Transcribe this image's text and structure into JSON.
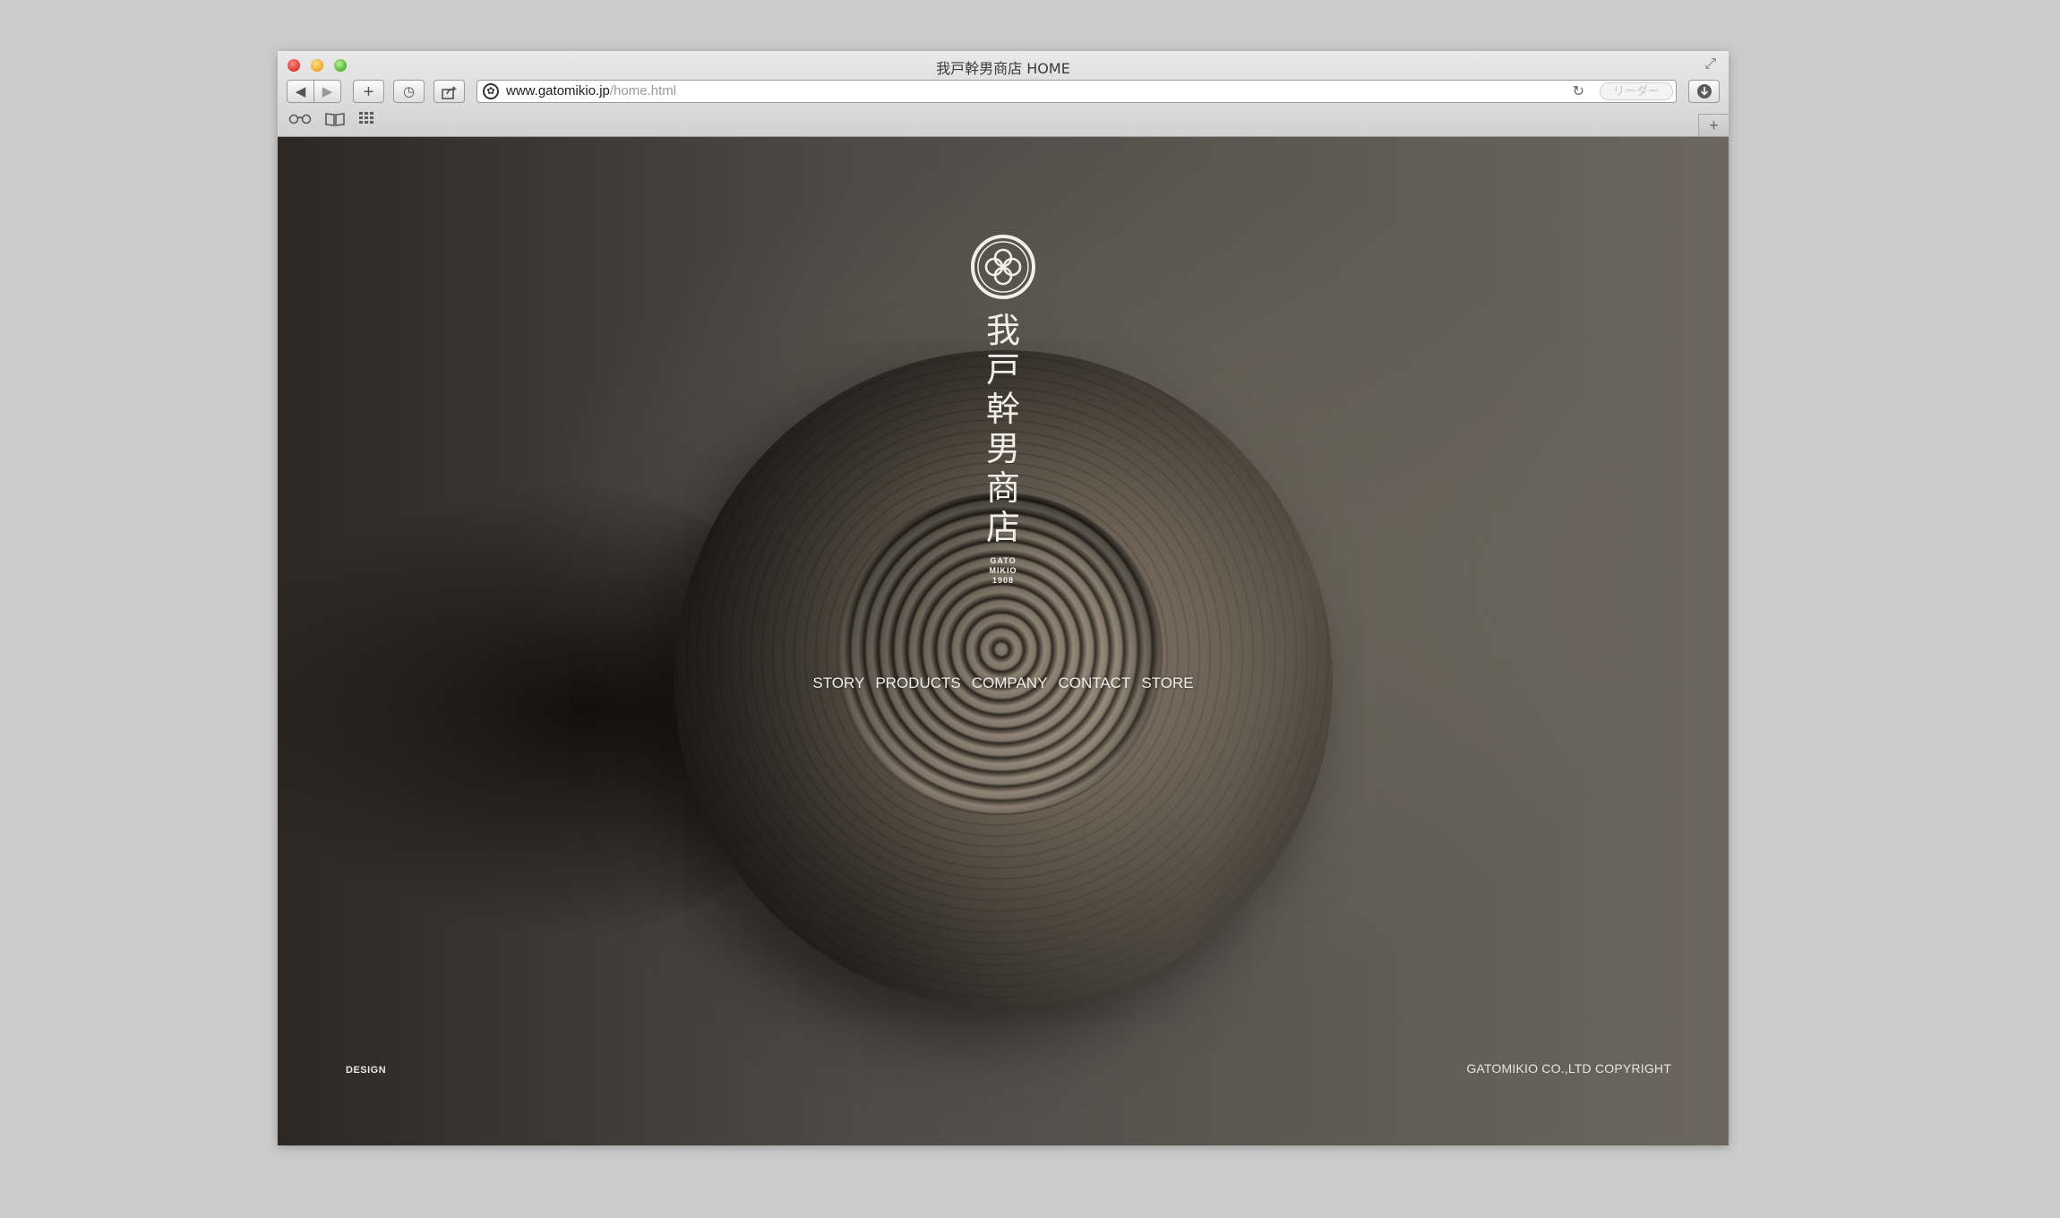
{
  "browser": {
    "window_title": "我戸幹男商店 HOME",
    "url_domain": "www.gatomikio.jp",
    "url_path": "/home.html",
    "reader_label": "リーダー",
    "icons": {
      "back": "back-arrow-icon",
      "forward": "forward-arrow-icon",
      "add": "plus-icon",
      "history": "clock-icon",
      "share": "share-icon",
      "reload": "reload-icon",
      "downloads": "download-icon",
      "reading_list": "glasses-icon",
      "bookmarks": "book-icon",
      "top_sites": "grid-icon",
      "new_tab": "plus-icon"
    }
  },
  "page": {
    "brand": {
      "name_chars": [
        "我",
        "戸",
        "幹",
        "男",
        "商",
        "店"
      ],
      "sub_lines": [
        "GATO",
        "MIKIO",
        "1908"
      ]
    },
    "nav": [
      {
        "label": "STORY"
      },
      {
        "label": "PRODUCTS"
      },
      {
        "label": "COMPANY"
      },
      {
        "label": "CONTACT"
      },
      {
        "label": "STORE"
      }
    ],
    "footer": {
      "left": "DESIGN",
      "right": "GATOMIKIO CO.,LTD COPYRIGHT"
    }
  },
  "colors": {
    "desktop_background": "#cbcbcb",
    "page_text": "#f2efea",
    "url_path": "#9a9a9a"
  }
}
